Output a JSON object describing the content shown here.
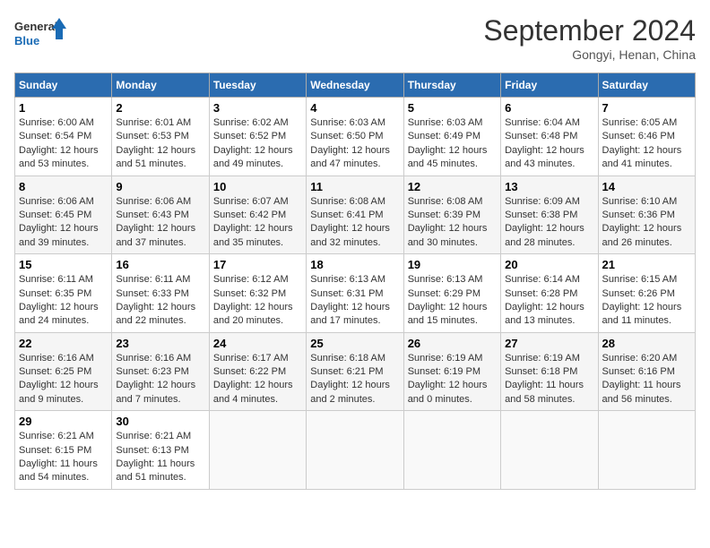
{
  "header": {
    "logo_line1": "General",
    "logo_line2": "Blue",
    "month_title": "September 2024",
    "subtitle": "Gongyi, Henan, China"
  },
  "days_of_week": [
    "Sunday",
    "Monday",
    "Tuesday",
    "Wednesday",
    "Thursday",
    "Friday",
    "Saturday"
  ],
  "weeks": [
    [
      {
        "day": "1",
        "info": "Sunrise: 6:00 AM\nSunset: 6:54 PM\nDaylight: 12 hours\nand 53 minutes."
      },
      {
        "day": "2",
        "info": "Sunrise: 6:01 AM\nSunset: 6:53 PM\nDaylight: 12 hours\nand 51 minutes."
      },
      {
        "day": "3",
        "info": "Sunrise: 6:02 AM\nSunset: 6:52 PM\nDaylight: 12 hours\nand 49 minutes."
      },
      {
        "day": "4",
        "info": "Sunrise: 6:03 AM\nSunset: 6:50 PM\nDaylight: 12 hours\nand 47 minutes."
      },
      {
        "day": "5",
        "info": "Sunrise: 6:03 AM\nSunset: 6:49 PM\nDaylight: 12 hours\nand 45 minutes."
      },
      {
        "day": "6",
        "info": "Sunrise: 6:04 AM\nSunset: 6:48 PM\nDaylight: 12 hours\nand 43 minutes."
      },
      {
        "day": "7",
        "info": "Sunrise: 6:05 AM\nSunset: 6:46 PM\nDaylight: 12 hours\nand 41 minutes."
      }
    ],
    [
      {
        "day": "8",
        "info": "Sunrise: 6:06 AM\nSunset: 6:45 PM\nDaylight: 12 hours\nand 39 minutes."
      },
      {
        "day": "9",
        "info": "Sunrise: 6:06 AM\nSunset: 6:43 PM\nDaylight: 12 hours\nand 37 minutes."
      },
      {
        "day": "10",
        "info": "Sunrise: 6:07 AM\nSunset: 6:42 PM\nDaylight: 12 hours\nand 35 minutes."
      },
      {
        "day": "11",
        "info": "Sunrise: 6:08 AM\nSunset: 6:41 PM\nDaylight: 12 hours\nand 32 minutes."
      },
      {
        "day": "12",
        "info": "Sunrise: 6:08 AM\nSunset: 6:39 PM\nDaylight: 12 hours\nand 30 minutes."
      },
      {
        "day": "13",
        "info": "Sunrise: 6:09 AM\nSunset: 6:38 PM\nDaylight: 12 hours\nand 28 minutes."
      },
      {
        "day": "14",
        "info": "Sunrise: 6:10 AM\nSunset: 6:36 PM\nDaylight: 12 hours\nand 26 minutes."
      }
    ],
    [
      {
        "day": "15",
        "info": "Sunrise: 6:11 AM\nSunset: 6:35 PM\nDaylight: 12 hours\nand 24 minutes."
      },
      {
        "day": "16",
        "info": "Sunrise: 6:11 AM\nSunset: 6:33 PM\nDaylight: 12 hours\nand 22 minutes."
      },
      {
        "day": "17",
        "info": "Sunrise: 6:12 AM\nSunset: 6:32 PM\nDaylight: 12 hours\nand 20 minutes."
      },
      {
        "day": "18",
        "info": "Sunrise: 6:13 AM\nSunset: 6:31 PM\nDaylight: 12 hours\nand 17 minutes."
      },
      {
        "day": "19",
        "info": "Sunrise: 6:13 AM\nSunset: 6:29 PM\nDaylight: 12 hours\nand 15 minutes."
      },
      {
        "day": "20",
        "info": "Sunrise: 6:14 AM\nSunset: 6:28 PM\nDaylight: 12 hours\nand 13 minutes."
      },
      {
        "day": "21",
        "info": "Sunrise: 6:15 AM\nSunset: 6:26 PM\nDaylight: 12 hours\nand 11 minutes."
      }
    ],
    [
      {
        "day": "22",
        "info": "Sunrise: 6:16 AM\nSunset: 6:25 PM\nDaylight: 12 hours\nand 9 minutes."
      },
      {
        "day": "23",
        "info": "Sunrise: 6:16 AM\nSunset: 6:23 PM\nDaylight: 12 hours\nand 7 minutes."
      },
      {
        "day": "24",
        "info": "Sunrise: 6:17 AM\nSunset: 6:22 PM\nDaylight: 12 hours\nand 4 minutes."
      },
      {
        "day": "25",
        "info": "Sunrise: 6:18 AM\nSunset: 6:21 PM\nDaylight: 12 hours\nand 2 minutes."
      },
      {
        "day": "26",
        "info": "Sunrise: 6:19 AM\nSunset: 6:19 PM\nDaylight: 12 hours\nand 0 minutes."
      },
      {
        "day": "27",
        "info": "Sunrise: 6:19 AM\nSunset: 6:18 PM\nDaylight: 11 hours\nand 58 minutes."
      },
      {
        "day": "28",
        "info": "Sunrise: 6:20 AM\nSunset: 6:16 PM\nDaylight: 11 hours\nand 56 minutes."
      }
    ],
    [
      {
        "day": "29",
        "info": "Sunrise: 6:21 AM\nSunset: 6:15 PM\nDaylight: 11 hours\nand 54 minutes."
      },
      {
        "day": "30",
        "info": "Sunrise: 6:21 AM\nSunset: 6:13 PM\nDaylight: 11 hours\nand 51 minutes."
      },
      {
        "day": "",
        "info": ""
      },
      {
        "day": "",
        "info": ""
      },
      {
        "day": "",
        "info": ""
      },
      {
        "day": "",
        "info": ""
      },
      {
        "day": "",
        "info": ""
      }
    ]
  ]
}
